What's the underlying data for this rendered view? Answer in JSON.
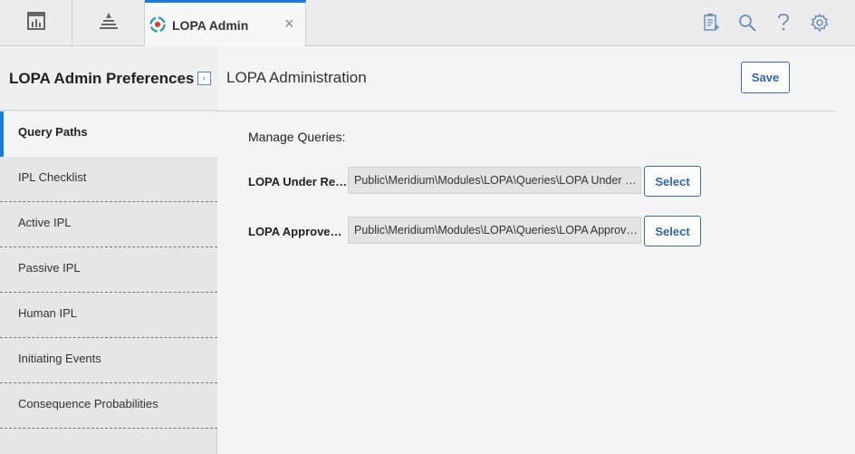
{
  "tabs": {
    "home_icon": "dashboard-icon",
    "nav_icon": "pyramid-icon",
    "active_tab": {
      "label": "LOPA Admin",
      "icon": "lopa-icon",
      "close": "×"
    }
  },
  "toolbar_icons": [
    "clipboard-add-icon",
    "search-icon",
    "help-icon",
    "gear-icon"
  ],
  "sidebar": {
    "title": "LOPA Admin Preferences",
    "collapse": "‹",
    "items": [
      {
        "label": "Query Paths"
      },
      {
        "label": "IPL Checklist"
      },
      {
        "label": "Active IPL"
      },
      {
        "label": "Passive IPL"
      },
      {
        "label": "Human IPL"
      },
      {
        "label": "Initiating Events"
      },
      {
        "label": "Consequence Probabilities"
      }
    ]
  },
  "main": {
    "title": "LOPA Administration",
    "save_label": "Save",
    "manage_label": "Manage Queries:",
    "queries": [
      {
        "label": "LOPA Under Revi...",
        "value": "Public\\Meridium\\Modules\\LOPA\\Queries\\LOPA Under Re...",
        "button": "Select"
      },
      {
        "label": "LOPA Approved Q...",
        "value": "Public\\Meridium\\Modules\\LOPA\\Queries\\LOPA Approved...",
        "button": "Select"
      }
    ]
  },
  "colors": {
    "accent": "#1d7ad6",
    "button_text": "#2f63b0"
  }
}
